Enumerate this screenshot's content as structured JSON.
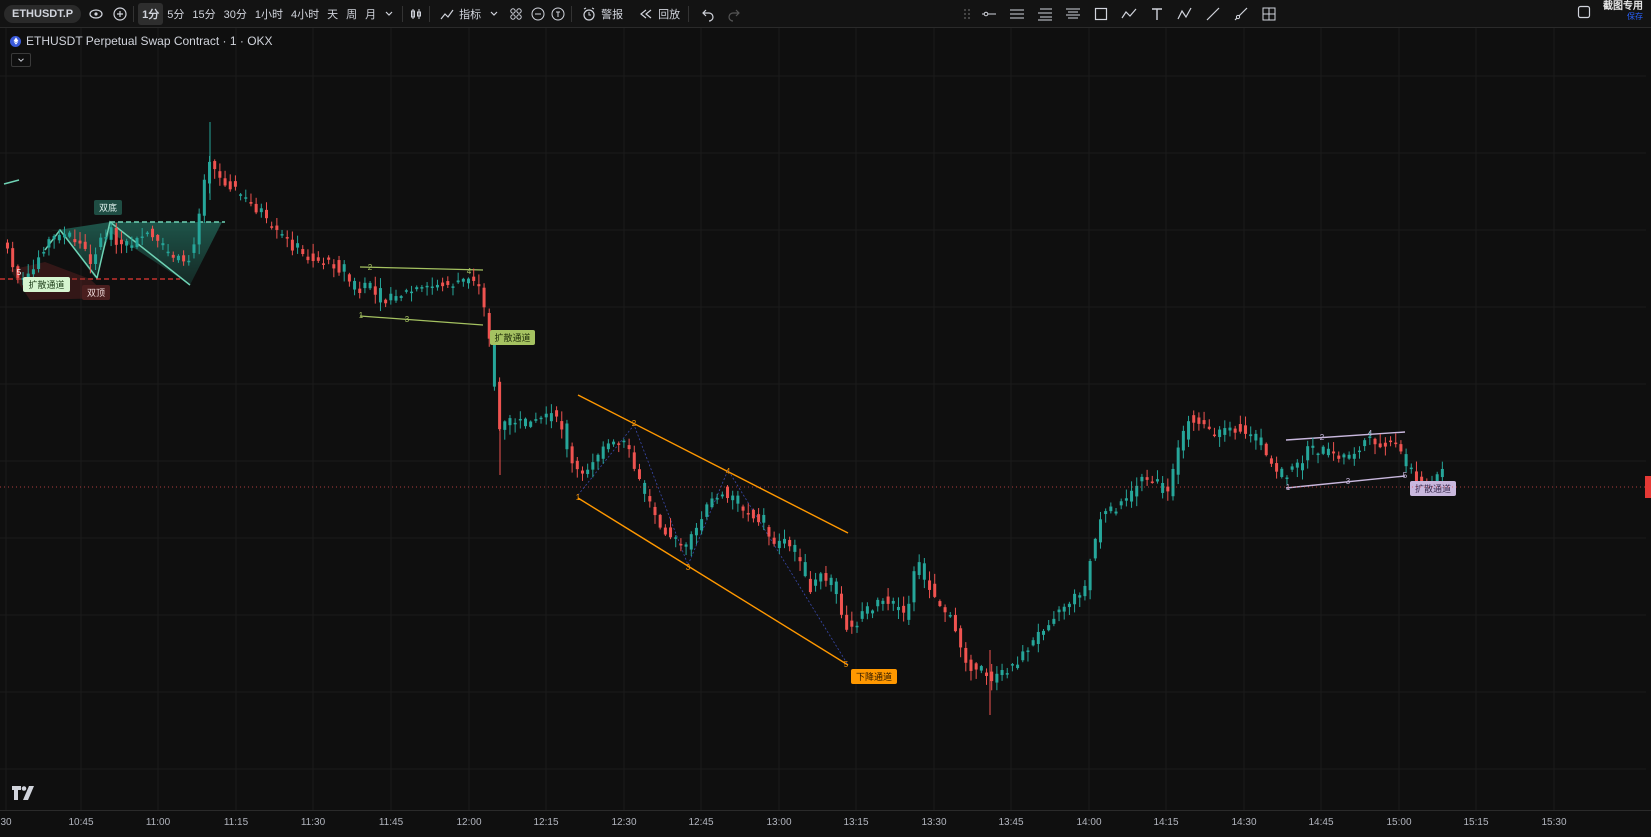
{
  "toolbar": {
    "symbol": "ETHUSDT.P",
    "timeframes": [
      "1分",
      "5分",
      "15分",
      "30分",
      "1小时",
      "4小时",
      "天",
      "周",
      "月"
    ],
    "active_timeframe": "1分",
    "indicators_label": "指标",
    "alert_label": "警报",
    "replay_label": "回放",
    "screenshot_label": "截图专用",
    "screenshot_sub": "保存"
  },
  "legend": {
    "title": "ETHUSDT Perpetual Swap Contract · 1 · OKX"
  },
  "xaxis": {
    "ticks": [
      "30",
      "10:45",
      "11:00",
      "11:15",
      "11:30",
      "11:45",
      "12:00",
      "12:15",
      "12:30",
      "12:45",
      "13:00",
      "13:15",
      "13:30",
      "13:45",
      "14:00",
      "14:15",
      "14:30",
      "14:45",
      "15:00",
      "15:15",
      "15:30"
    ]
  },
  "annotations": {
    "double_bottom": "双底",
    "double_top": "双顶",
    "broadening_channel": "扩散通道",
    "descending_channel": "下降通道",
    "wave_5": "5",
    "wave_labels": [
      "1",
      "2",
      "3",
      "4",
      "5"
    ]
  },
  "colors": {
    "bull": "#26a69a",
    "bear": "#ef5350",
    "orange": "#ff9800",
    "lime": "#a5c261",
    "lavender": "#c9b8de",
    "teal_pattern": "#1f5b4f"
  },
  "icons": {
    "indicators": "chart-fx-icon",
    "alert": "alarm-clock-icon",
    "replay": "rewind-icon",
    "undo": "undo-icon",
    "redo": "redo-icon"
  }
}
